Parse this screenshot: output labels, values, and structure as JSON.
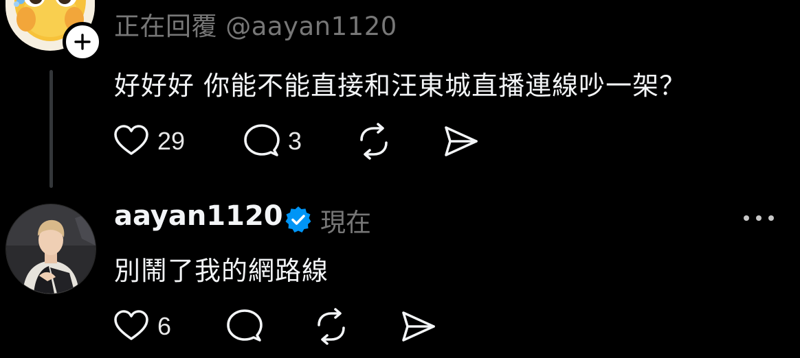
{
  "colors": {
    "background": "#000000",
    "primary_text": "#f3f5f7",
    "secondary_text": "#777777",
    "verified_blue": "#0095f6",
    "thread_line": "#333639"
  },
  "posts": [
    {
      "avatar_icon": "emoji-avatar",
      "reply_to": "正在回覆 @aayan1120",
      "text": "好好好 你能不能直接和汪東城直播連線吵一架？",
      "actions": {
        "like_count": "29",
        "comment_count": "3"
      }
    },
    {
      "avatar_icon": "profile-photo",
      "username": "aayan1120",
      "verified": true,
      "timestamp": "現在",
      "text": "別鬧了我的網路線",
      "actions": {
        "like_count": "6"
      }
    }
  ],
  "icons": {
    "like": "heart-icon",
    "comment": "speech-bubble-icon",
    "repost": "repost-icon",
    "share": "send-icon",
    "follow": "plus-icon",
    "more": "ellipsis-icon",
    "verified": "verified-badge-icon"
  }
}
